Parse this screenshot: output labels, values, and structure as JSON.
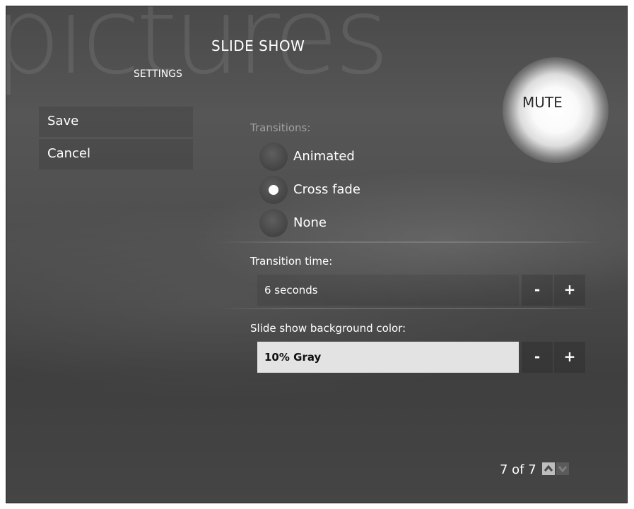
{
  "header": {
    "watermark": "pictures",
    "title": "SLIDE SHOW",
    "subtitle": "SETTINGS"
  },
  "mute": {
    "label": "MUTE"
  },
  "sidebar": {
    "save_label": "Save",
    "cancel_label": "Cancel"
  },
  "transitions": {
    "label": "Transitions:",
    "options": [
      {
        "label": "Animated",
        "selected": false
      },
      {
        "label": "Cross fade",
        "selected": true
      },
      {
        "label": "None",
        "selected": false
      }
    ]
  },
  "transition_time": {
    "label": "Transition time:",
    "value": "6 seconds",
    "minus_label": "-",
    "plus_label": "+"
  },
  "background_color": {
    "label": "Slide show background color:",
    "value": "10% Gray",
    "minus_label": "-",
    "plus_label": "+"
  },
  "pager": {
    "text": "7 of 7"
  },
  "icons": {
    "page_up": "chevron-up-icon",
    "page_down": "chevron-down-icon"
  },
  "colors": {
    "background": "#4e4e4e",
    "text": "#ffffff",
    "field_highlight": "#e3e3e3"
  }
}
